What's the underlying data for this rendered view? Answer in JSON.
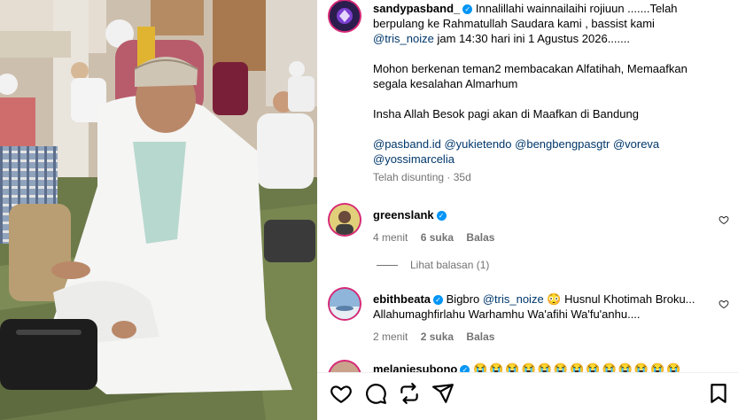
{
  "post": {
    "username": "sandypasband_",
    "caption_lines": [
      "Innalillahi wainnailaihi rojiuun .......Telah",
      "berpulang ke Rahmatullah Saudara kami , bassist kami"
    ],
    "caption_mention": "@tris_noize",
    "caption_line3_rest": " jam 14:30 hari ini 1 Agustus 2026.......",
    "paragraph2_line1": "Mohon berkenan teman2 membacakan Alfatihah, Memaafkan",
    "paragraph2_line2": "segala kesalahan Almarhum",
    "paragraph3": "Insha Allah Besok pagi akan di Maafkan di Bandung",
    "tags_line1": [
      "@pasband.id",
      "@yukietendo",
      "@bengbengpasgtr",
      "@voreva"
    ],
    "tags_line2": [
      "@yossimarcelia"
    ],
    "edited_meta": "Telah disunting · 35d"
  },
  "comments": [
    {
      "username": "greenslank",
      "text": "",
      "time": "4 menit",
      "likes": "6 suka",
      "reply": "Balas"
    },
    {
      "username": "ebithbeata",
      "text_before": "Bigbro ",
      "mention": "@tris_noize",
      "text_after": " 😳 Husnul Khotimah Broku...",
      "line2": "Allahumaghfirlahu Warhamhu Wa'afihi Wa'fu'anhu....",
      "time": "2 menit",
      "likes": "2 suka",
      "reply": "Balas"
    },
    {
      "username": "melaniesubono",
      "emojis": "😭😭😭😭😭😭😭😭😭😭😭😭😭"
    }
  ],
  "view_replies": "Lihat balasan (1)",
  "icons": {
    "like": "heart-icon",
    "comment": "comment-icon",
    "share": "repost-icon",
    "send": "send-icon",
    "save": "bookmark-icon"
  }
}
